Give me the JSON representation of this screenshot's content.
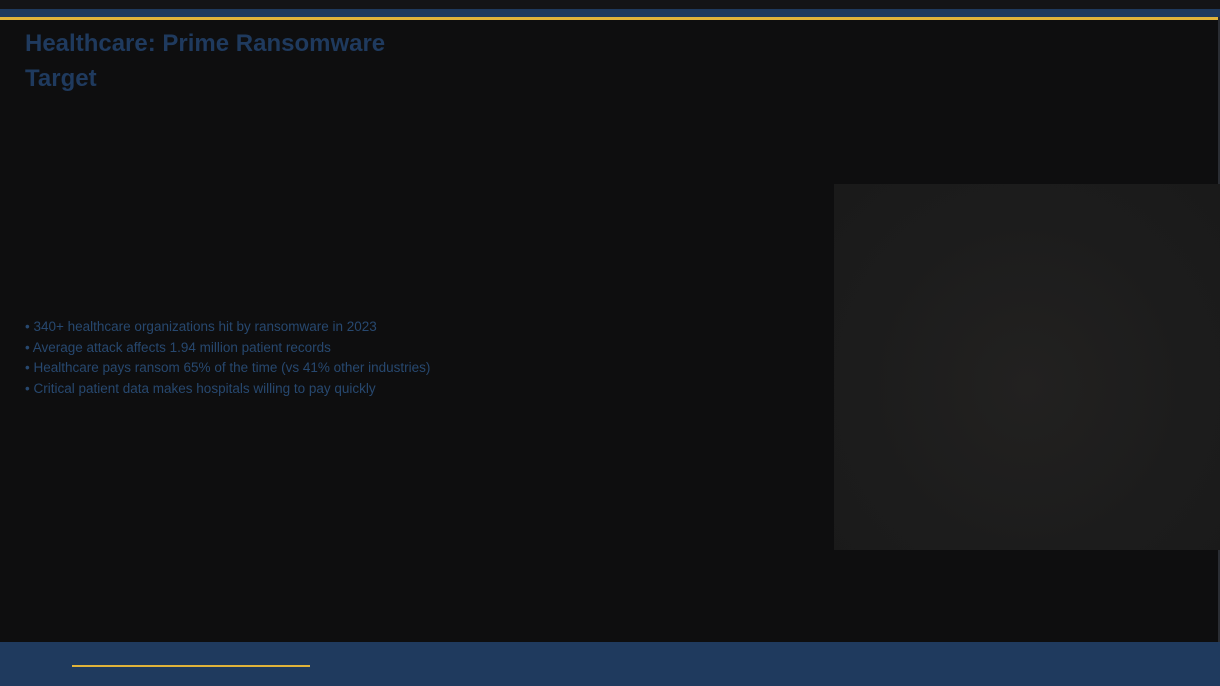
{
  "slide": {
    "title": "Healthcare: Prime Ransomware Target",
    "bullets": [
      "• 340+ healthcare organizations hit by ransomware in 2023",
      "• Average attack affects 1.94 million patient records",
      "• Healthcare pays ransom 65% of the time (vs 41% other industries)",
      "• Critical patient data makes hospitals willing to pay quickly"
    ]
  },
  "colors": {
    "background": "#0e0e0f",
    "navy": "#1f3a5e",
    "gold": "#e0b33a",
    "text": "#27486f"
  }
}
